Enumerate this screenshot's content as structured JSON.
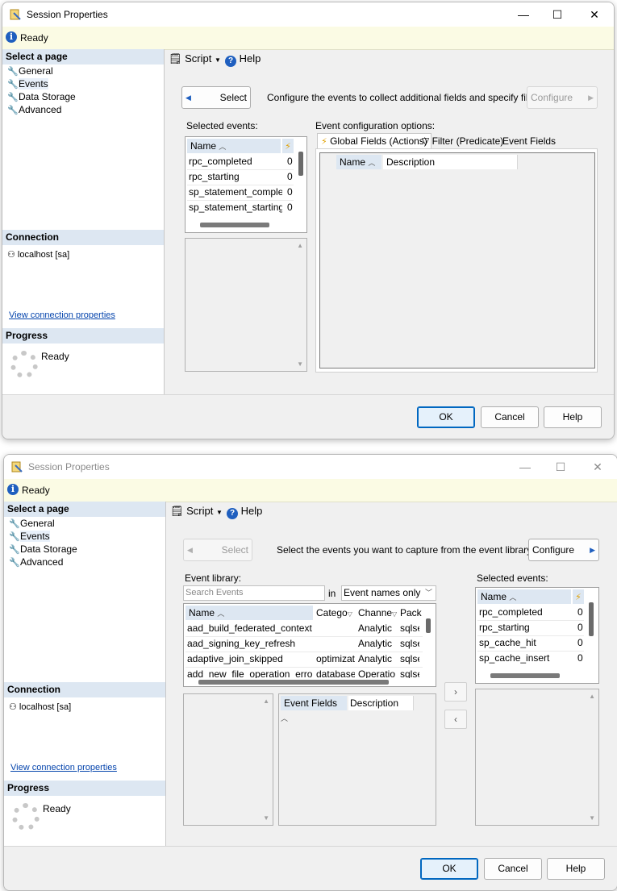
{
  "window1": {
    "title": "Session Properties",
    "status": "Ready",
    "left_pane": {
      "select_page_header": "Select a page",
      "pages": [
        "General",
        "Events",
        "Data Storage",
        "Advanced"
      ],
      "connection_header": "Connection",
      "connection": "localhost [sa]",
      "view_connection_link": "View connection properties",
      "progress_header": "Progress",
      "progress_status": "Ready"
    },
    "toolbar": {
      "script_label": "Script",
      "help_label": "Help"
    },
    "select_button": "Select",
    "instruction": "Configure the events to collect additional fields and specify filters.",
    "configure_button": "Configure",
    "selected_events_label": "Selected events:",
    "selected_events": {
      "header_name": "Name",
      "rows": [
        {
          "name": "rpc_completed",
          "count": "0"
        },
        {
          "name": "rpc_starting",
          "count": "0"
        },
        {
          "name": "sp_statement_comple...",
          "count": "0"
        },
        {
          "name": "sp_statement_starting",
          "count": "0"
        }
      ]
    },
    "event_config_label": "Event configuration options:",
    "tabs": [
      "Global Fields (Actions)",
      "Filter (Predicate)",
      "Event Fields"
    ],
    "config_grid": {
      "col_name": "Name",
      "col_description": "Description"
    },
    "footer": {
      "ok": "OK",
      "cancel": "Cancel",
      "help": "Help"
    }
  },
  "window2": {
    "title": "Session Properties",
    "status": "Ready",
    "left_pane": {
      "select_page_header": "Select a page",
      "pages": [
        "General",
        "Events",
        "Data Storage",
        "Advanced"
      ],
      "connection_header": "Connection",
      "connection": "localhost [sa]",
      "view_connection_link": "View connection properties",
      "progress_header": "Progress",
      "progress_status": "Ready"
    },
    "toolbar": {
      "script_label": "Script",
      "help_label": "Help"
    },
    "select_button": "Select",
    "instruction": "Select the events you want to capture from the event library.",
    "configure_button": "Configure",
    "event_library_label": "Event library:",
    "search_placeholder": "Search Events",
    "in_label": "in",
    "search_scope": "Event names only",
    "library": {
      "headers": [
        "Name",
        "Catego",
        "Channe",
        "Pack"
      ],
      "rows": [
        {
          "name": "aad_build_federated_context",
          "category": "",
          "channel": "Analytic",
          "package": "sqlse"
        },
        {
          "name": "aad_signing_key_refresh",
          "category": "",
          "channel": "Analytic",
          "package": "sqlse"
        },
        {
          "name": "adaptive_join_skipped",
          "category": "optimizat...",
          "channel": "Analytic",
          "package": "sqlse"
        },
        {
          "name": "add_new_file_operation_error",
          "category": "database",
          "channel": "Operatio",
          "package": "sqlse"
        }
      ]
    },
    "fields_grid": {
      "col_fields": "Event Fields",
      "col_description": "Description"
    },
    "add_arrow": "›",
    "remove_arrow": "‹",
    "selected_events_label": "Selected events:",
    "selected_events": {
      "header_name": "Name",
      "rows": [
        {
          "name": "rpc_completed",
          "count": "0"
        },
        {
          "name": "rpc_starting",
          "count": "0"
        },
        {
          "name": "sp_cache_hit",
          "count": "0"
        },
        {
          "name": "sp_cache_insert",
          "count": "0"
        }
      ]
    },
    "footer": {
      "ok": "OK",
      "cancel": "Cancel",
      "help": "Help"
    }
  }
}
